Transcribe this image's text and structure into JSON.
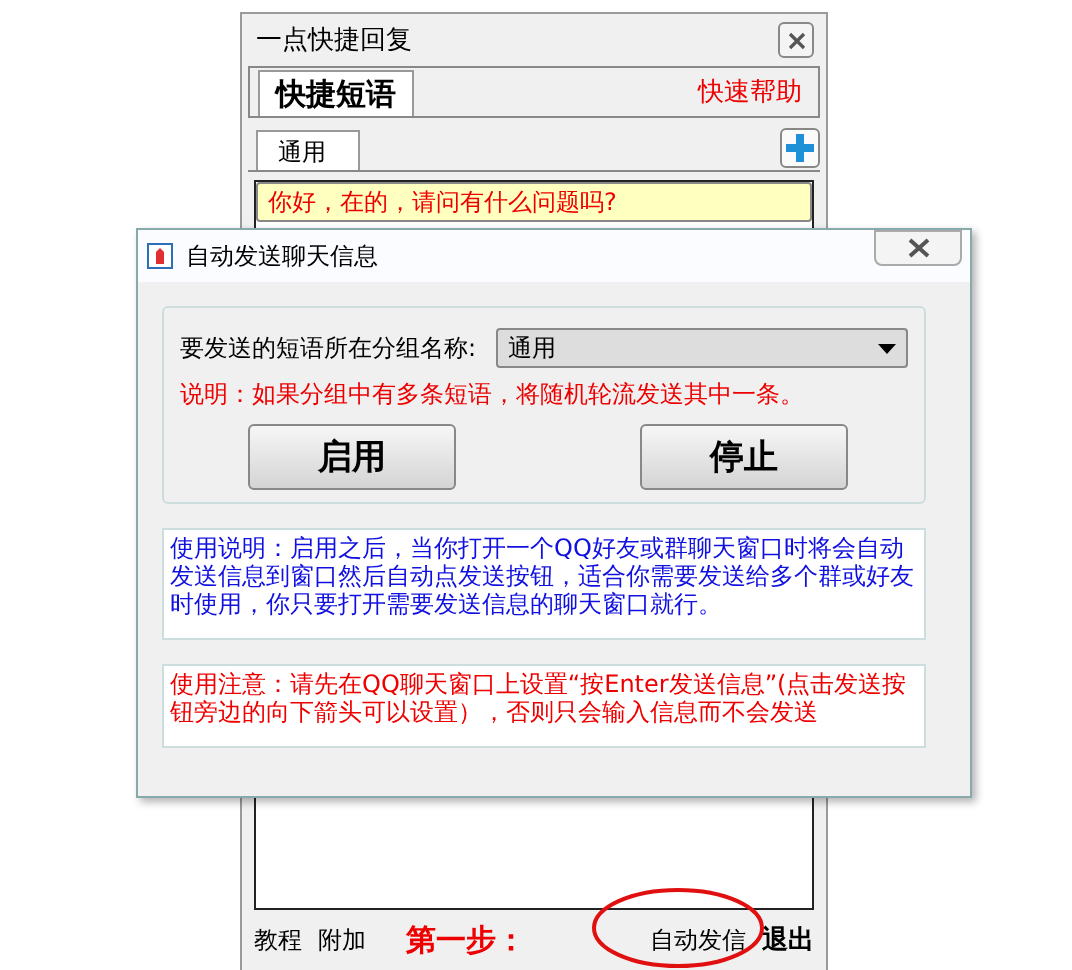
{
  "back_window": {
    "title": "一点快捷回复",
    "tabs": [
      {
        "label": "快捷短语",
        "selected": true
      }
    ],
    "help_link": "快速帮助",
    "groups": [
      {
        "label": "通用",
        "selected": true
      }
    ],
    "phrases": [
      {
        "text": "你好，在的，请问有什么问题吗?",
        "selected": true
      }
    ],
    "footer": {
      "links": [
        "教程",
        "附加"
      ],
      "annotation": "第一步：",
      "auto_send": "自动发信",
      "exit": "退出"
    }
  },
  "dialog": {
    "title": "自动发送聊天信息",
    "group_label": "要发送的短语所在分组名称:",
    "group_value": "通用",
    "note": "说明：如果分组中有多条短语，将随机轮流发送其中一条。",
    "buttons": [
      "启用",
      "停止"
    ],
    "usage": "使用说明：启用之后，当你打开一个QQ好友或群聊天窗口时将会自动发送信息到窗口然后自动点发送按钮，适合你需要发送给多个群或好友时使用，你只要打开需要发送信息的聊天窗口就行。",
    "warning": "使用注意：请先在QQ聊天窗口上设置“按Enter发送信息”(点击发送按钮旁边的向下箭头可以设置），否则只会输入信息而不会发送"
  }
}
